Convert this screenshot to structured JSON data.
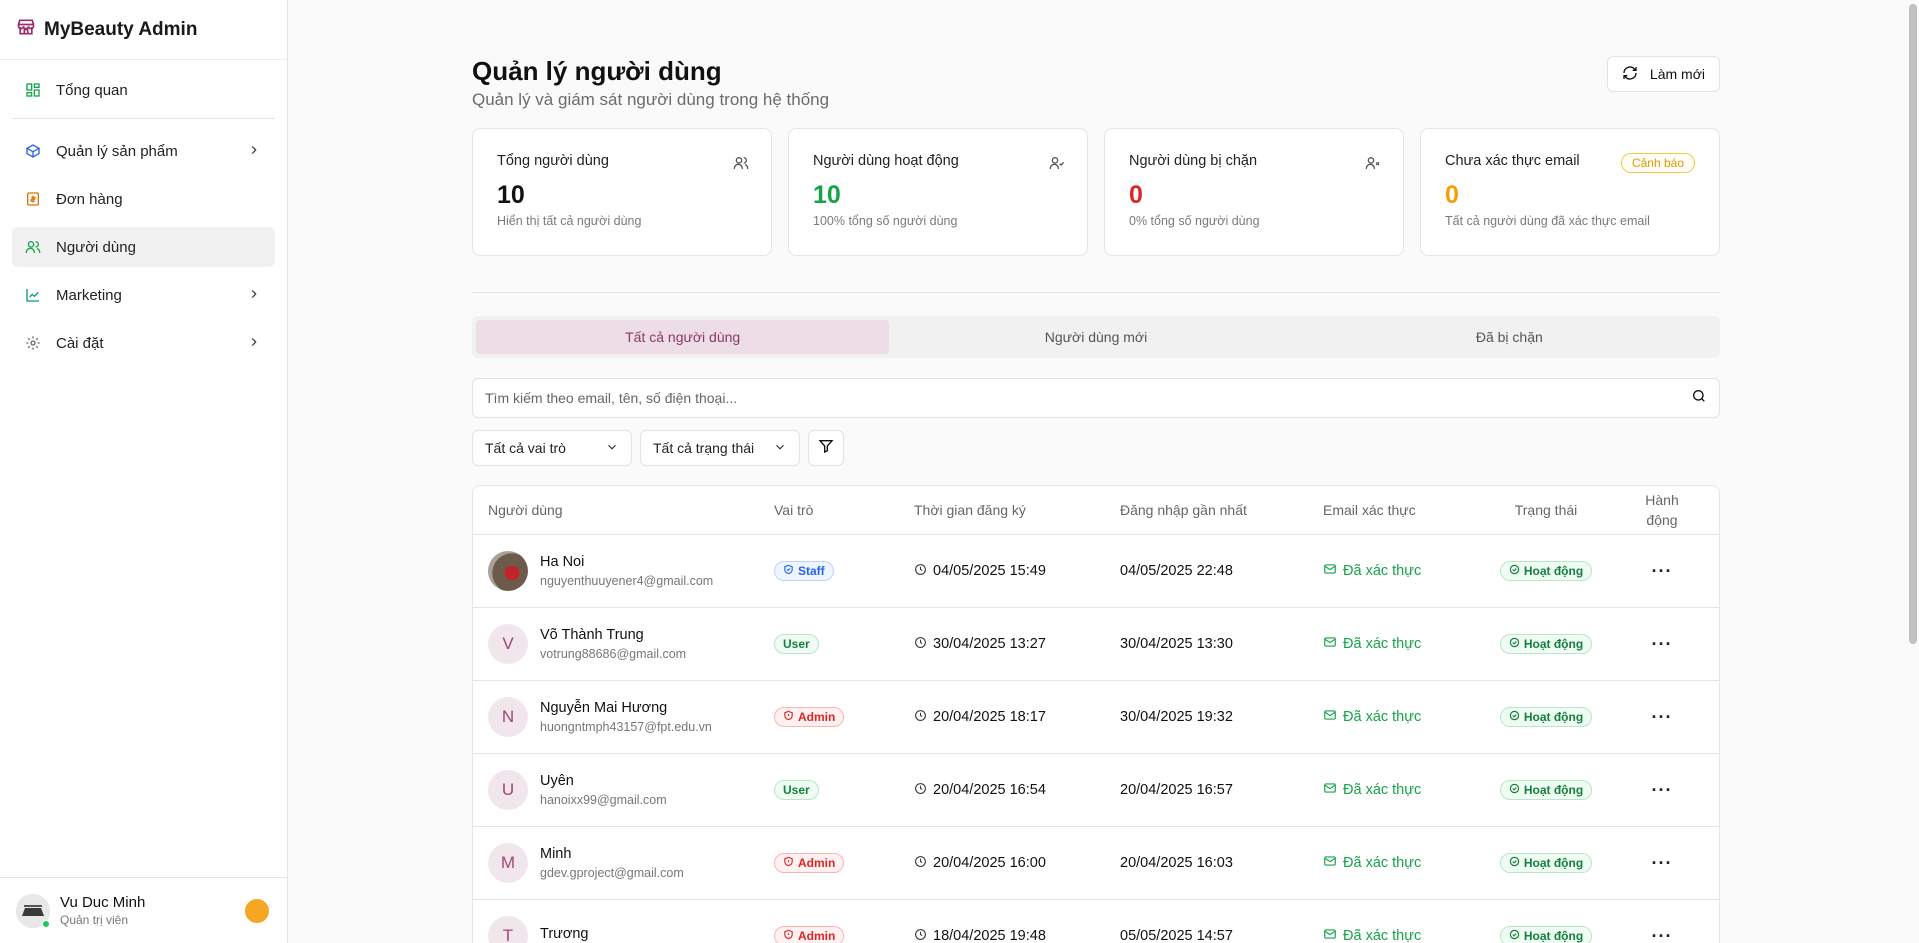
{
  "brand": {
    "title": "MyBeauty Admin"
  },
  "sidebar": {
    "items": [
      {
        "label": "Tổng quan"
      },
      {
        "label": "Quản lý sản phẩm"
      },
      {
        "label": "Đơn hàng"
      },
      {
        "label": "Người dùng"
      },
      {
        "label": "Marketing"
      },
      {
        "label": "Cài đặt"
      }
    ],
    "user": {
      "name": "Vu Duc Minh",
      "role": "Quản trị viên"
    }
  },
  "header": {
    "title": "Quản lý người dùng",
    "subtitle": "Quản lý và giám sát người dùng trong hệ thống",
    "refresh_label": "Làm mới"
  },
  "stats": [
    {
      "label": "Tổng người dùng",
      "value": "10",
      "note": "Hiển thị tất cả người dùng",
      "color": "#111111"
    },
    {
      "label": "Người dùng hoạt động",
      "value": "10",
      "note": "100% tổng số người dùng",
      "color": "#16a34a"
    },
    {
      "label": "Người dùng bị chặn",
      "value": "0",
      "note": "0% tổng số người dùng",
      "color": "#dc2626"
    },
    {
      "label": "Chưa xác thực email",
      "value": "0",
      "note": "Tất cả người dùng đã xác thực email",
      "color": "#f59e0b",
      "badge": "Cảnh báo"
    }
  ],
  "tabs": [
    {
      "label": "Tất cả người dùng"
    },
    {
      "label": "Người dùng mới"
    },
    {
      "label": "Đã bị chặn"
    }
  ],
  "search": {
    "placeholder": "Tìm kiếm theo email, tên, số điện thoại..."
  },
  "filters": {
    "role": "Tất cả vai trò",
    "status": "Tất cả trạng thái"
  },
  "table": {
    "headers": {
      "user": "Người dùng",
      "role": "Vai trò",
      "registered": "Thời gian đăng ký",
      "last_login": "Đăng nhập gần nhất",
      "email_verify": "Email xác thực",
      "status": "Trạng thái",
      "actions_1": "Hành",
      "actions_2": "động"
    },
    "rows": [
      {
        "initial": "",
        "name": "Ha Noi",
        "email": "nguyenthuuyener4@gmail.com",
        "role": "Staff",
        "registered": "04/05/2025 15:49",
        "last_login": "04/05/2025 22:48",
        "verified": "Đã xác thực",
        "status": "Hoạt động"
      },
      {
        "initial": "V",
        "name": "Võ Thành Trung",
        "email": "votrung88686@gmail.com",
        "role": "User",
        "registered": "30/04/2025 13:27",
        "last_login": "30/04/2025 13:30",
        "verified": "Đã xác thực",
        "status": "Hoạt động"
      },
      {
        "initial": "N",
        "name": "Nguyễn Mai Hương",
        "email": "huongntmph43157@fpt.edu.vn",
        "role": "Admin",
        "registered": "20/04/2025 18:17",
        "last_login": "30/04/2025 19:32",
        "verified": "Đã xác thực",
        "status": "Hoạt động"
      },
      {
        "initial": "U",
        "name": "Uyên",
        "email": "hanoixx99@gmail.com",
        "role": "User",
        "registered": "20/04/2025 16:54",
        "last_login": "20/04/2025 16:57",
        "verified": "Đã xác thực",
        "status": "Hoạt động"
      },
      {
        "initial": "M",
        "name": "Minh",
        "email": "gdev.gproject@gmail.com",
        "role": "Admin",
        "registered": "20/04/2025 16:00",
        "last_login": "20/04/2025 16:03",
        "verified": "Đã xác thực",
        "status": "Hoạt động"
      },
      {
        "initial": "T",
        "name": "Trương",
        "email": "",
        "role": "Admin",
        "registered": "18/04/2025 19:48",
        "last_login": "05/05/2025 14:57",
        "verified": "Đã xác thực",
        "status": "Hoạt động"
      }
    ]
  },
  "colors": {
    "accent": "#8a3a66",
    "active_tab_bg": "#ecdde6",
    "success": "#16a34a",
    "danger": "#dc2626",
    "warning": "#f59e0b"
  }
}
